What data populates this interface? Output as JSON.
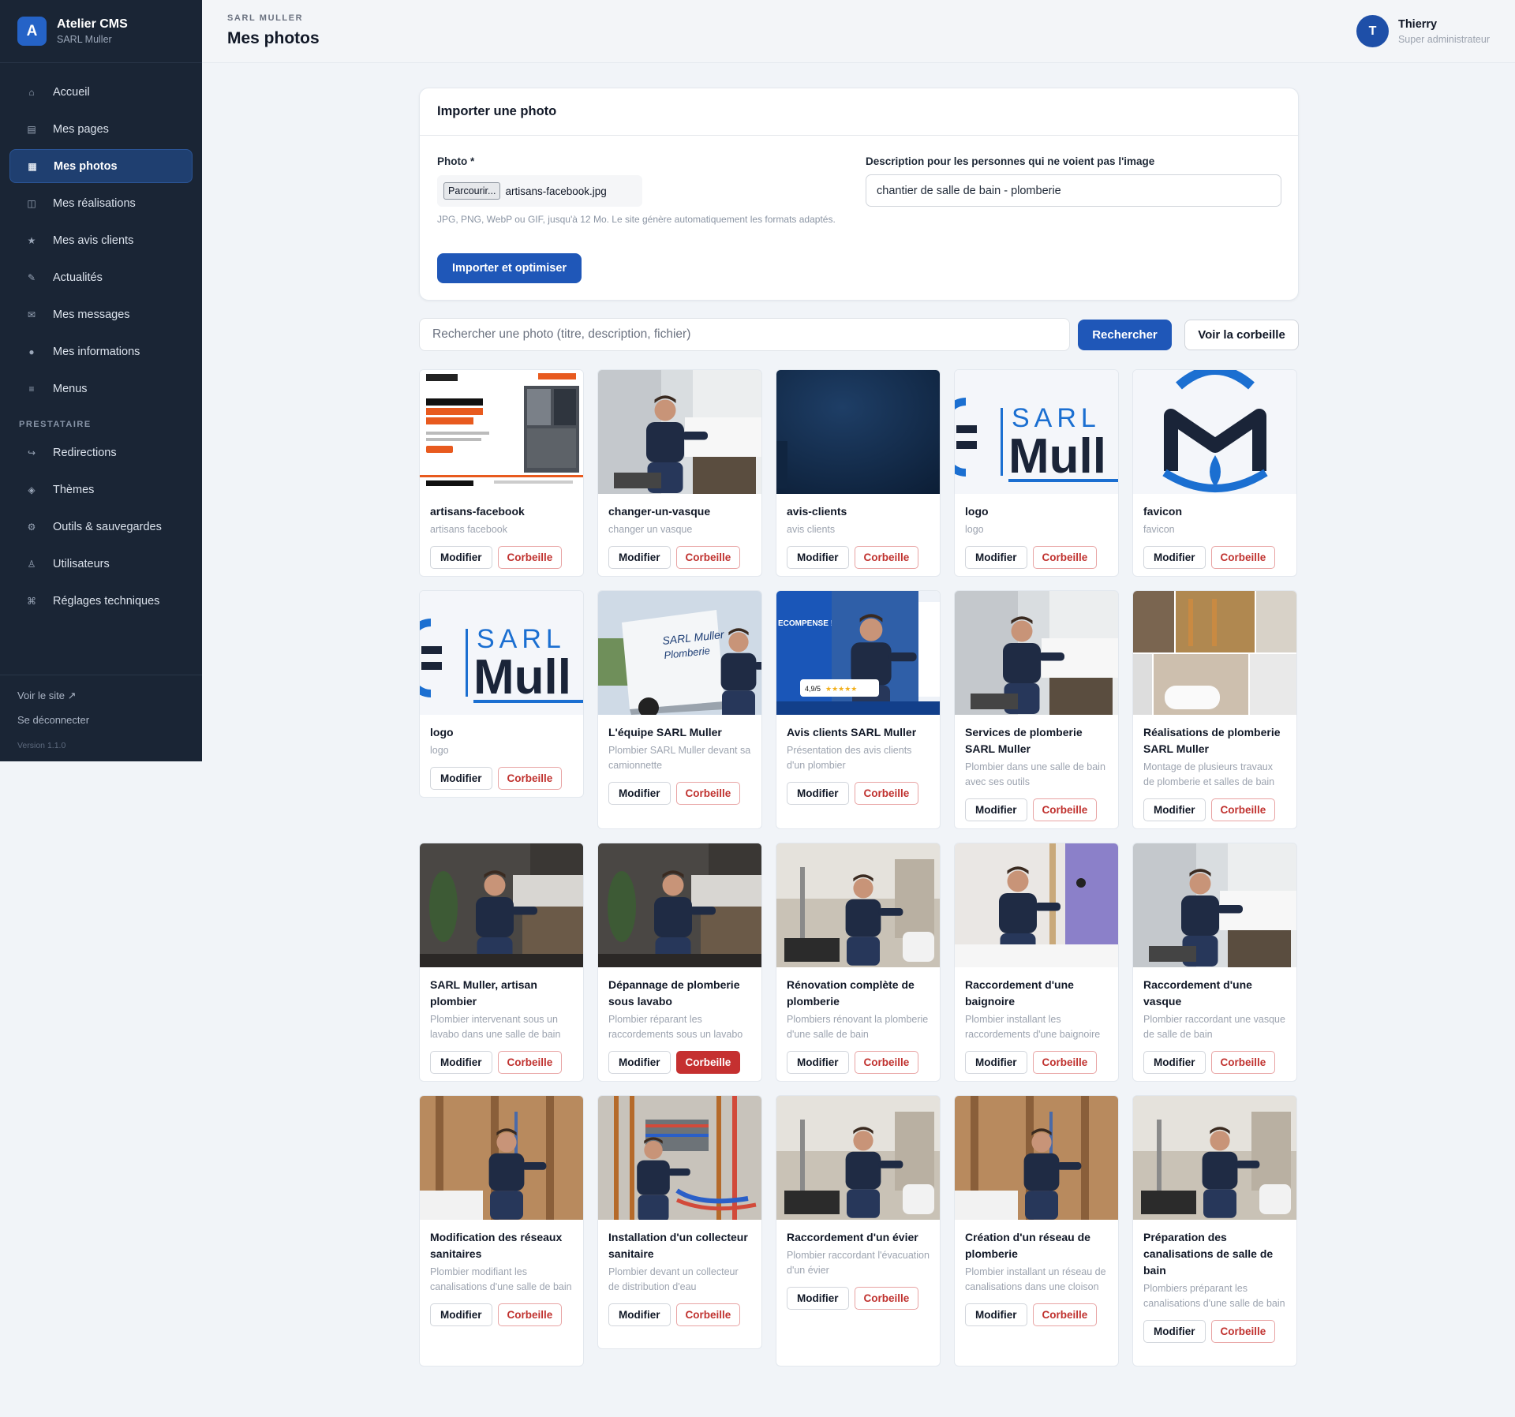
{
  "brand": {
    "logo_letter": "A",
    "title": "Atelier CMS",
    "subtitle": "SARL Muller",
    "accent": "#2563c7"
  },
  "nav": {
    "items": [
      {
        "label": "Accueil",
        "icon": "home-icon",
        "glyph": "⌂"
      },
      {
        "label": "Mes pages",
        "icon": "pages-icon",
        "glyph": "▤"
      },
      {
        "label": "Mes photos",
        "icon": "photos-icon",
        "glyph": "▦",
        "active": true
      },
      {
        "label": "Mes réalisations",
        "icon": "realisations-icon",
        "glyph": "◫"
      },
      {
        "label": "Mes avis clients",
        "icon": "star-icon",
        "glyph": "★"
      },
      {
        "label": "Actualités",
        "icon": "pen-icon",
        "glyph": "✎"
      },
      {
        "label": "Mes messages",
        "icon": "mail-icon",
        "glyph": "✉"
      },
      {
        "label": "Mes informations",
        "icon": "info-icon",
        "glyph": "●"
      },
      {
        "label": "Menus",
        "icon": "menu-icon",
        "glyph": "≡"
      }
    ],
    "section_label": "PRESTATAIRE",
    "section_items": [
      {
        "label": "Redirections",
        "icon": "redirect-icon",
        "glyph": "↪"
      },
      {
        "label": "Thèmes",
        "icon": "theme-icon",
        "glyph": "◈"
      },
      {
        "label": "Outils & sauvegardes",
        "icon": "tools-icon",
        "glyph": "⚙"
      },
      {
        "label": "Utilisateurs",
        "icon": "users-icon",
        "glyph": "♙"
      },
      {
        "label": "Réglages techniques",
        "icon": "settings-icon",
        "glyph": "⌘"
      }
    ],
    "footer": {
      "view_site": "Voir le site ↗",
      "logout": "Se déconnecter",
      "version": "Version 1.1.0"
    }
  },
  "header": {
    "kicker": "SARL MULLER",
    "title": "Mes photos"
  },
  "user": {
    "initial": "T",
    "name": "Thierry",
    "role": "Super administrateur"
  },
  "import": {
    "title": "Importer une photo",
    "photo_label": "Photo *",
    "browse_label": "Parcourir...",
    "file_name": "artisans-facebook.jpg",
    "hint": "JPG, PNG, WebP ou GIF, jusqu'à 12 Mo. Le site génère automatiquement les formats adaptés.",
    "submit_label": "Importer et optimiser",
    "desc_label": "Description pour les personnes qui ne voient pas l'image",
    "desc_value": "chantier de salle de bain - plomberie"
  },
  "search": {
    "placeholder": "Rechercher une photo (titre, description, fichier)",
    "button": "Rechercher",
    "trash_button": "Voir la corbeille"
  },
  "tile_actions": {
    "edit": "Modifier",
    "delete": "Corbeille"
  },
  "photos": [
    {
      "title": "artisans-facebook",
      "desc": "artisans facebook",
      "thumb": "webpage"
    },
    {
      "title": "changer-un-vasque",
      "desc": "changer un vasque",
      "thumb": "plumber-light"
    },
    {
      "title": "avis-clients",
      "desc": "avis clients",
      "thumb": "dark-blue"
    },
    {
      "title": "logo",
      "desc": "logo",
      "thumb": "logo"
    },
    {
      "title": "favicon",
      "desc": "favicon",
      "thumb": "favicon"
    },
    {
      "title": "logo",
      "desc": "logo",
      "thumb": "logo"
    },
    {
      "title": "L'équipe SARL Muller",
      "desc": "Plombier SARL Muller devant sa camionnette",
      "thumb": "van"
    },
    {
      "title": "Avis clients SARL Muller",
      "desc": "Présentation des avis clients d'un plombier",
      "thumb": "reviews"
    },
    {
      "title": "Services de plomberie SARL Muller",
      "desc": "Plombier dans une salle de bain avec ses outils",
      "thumb": "plumber-light"
    },
    {
      "title": "Réalisations de plomberie SARL Muller",
      "desc": "Montage de plusieurs travaux de plomberie et salles de bain",
      "thumb": "collage"
    },
    {
      "title": "SARL Muller, artisan plombier",
      "desc": "Plombier intervenant sous un lavabo dans une salle de bain",
      "thumb": "plumber-dark"
    },
    {
      "title": "Dépannage de plomberie sous lavabo",
      "desc": "Plombier réparant les raccordements sous un lavabo",
      "thumb": "plumber-dark",
      "hot": true
    },
    {
      "title": "Rénovation complète de plomberie",
      "desc": "Plombiers rénovant la plomberie d'une salle de bain",
      "thumb": "site"
    },
    {
      "title": "Raccordement d'une baignoire",
      "desc": "Plombier installant les raccordements d'une baignoire",
      "thumb": "purple"
    },
    {
      "title": "Raccordement d'une vasque",
      "desc": "Plombier raccordant une vasque de salle de bain",
      "thumb": "plumber-light"
    },
    {
      "title": "Modification des réseaux sanitaires",
      "desc": "Plombier modifiant les canalisations d'une salle de bain",
      "thumb": "wood"
    },
    {
      "title": "Installation d'un collecteur sanitaire",
      "desc": "Plombier devant un collecteur de distribution d'eau",
      "thumb": "pipes"
    },
    {
      "title": "Raccordement d'un évier",
      "desc": "Plombier raccordant l'évacuation d'un évier",
      "thumb": "site"
    },
    {
      "title": "Création d'un réseau de plomberie",
      "desc": "Plombier installant un réseau de canalisations dans une cloison",
      "thumb": "wood"
    },
    {
      "title": "Préparation des canalisations de salle de bain",
      "desc": "Plombiers préparant les canalisations d'une salle de bain",
      "thumb": "site"
    }
  ],
  "colors": {
    "sidebar_bg": "#1a2535",
    "primary": "#1f57b8",
    "danger": "#c0322f"
  }
}
